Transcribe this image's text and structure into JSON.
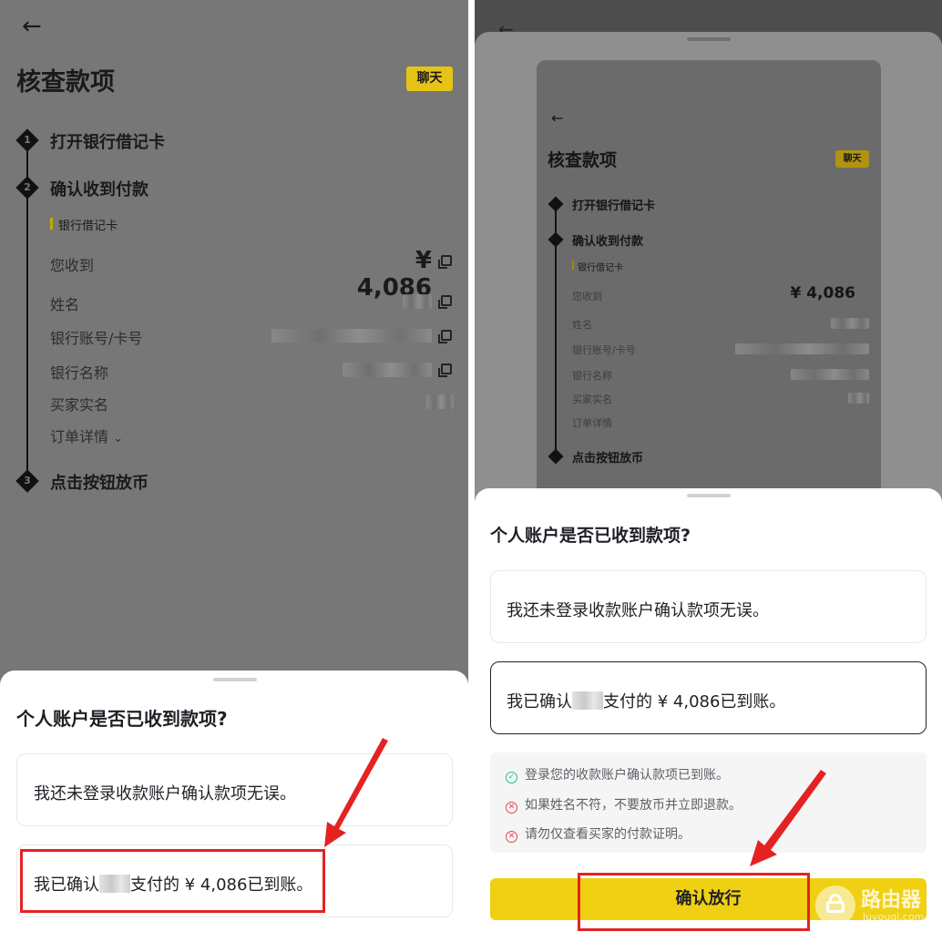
{
  "order": {
    "back_icon": "arrow-left-icon",
    "title": "核查款项",
    "chat_label": "聊天",
    "steps": [
      {
        "num": "1",
        "label": "打开银行借记卡"
      },
      {
        "num": "2",
        "label": "确认收到付款"
      },
      {
        "num": "3",
        "label": "点击按钮放币"
      }
    ],
    "bank_tag": "银行借记卡",
    "rows": {
      "received_label": "您收到",
      "amount": "¥ 4,086",
      "name_label": "姓名",
      "account_label": "银行账号/卡号",
      "bank_name_label": "银行名称",
      "buyer_label": "买家实名",
      "details_label": "订单详情",
      "details_chevron": "⌄"
    }
  },
  "sheet": {
    "title": "个人账户是否已收到款项?",
    "option_not_logged": "我还未登录收款账户确认款项无误。",
    "option_confirm_prefix": "我已确认",
    "option_confirm_suffix": "支付的 ¥ 4,086已到账。",
    "hints": [
      {
        "icon": "check-circle-icon",
        "text": "登录您的收款账户确认款项已到账。"
      },
      {
        "icon": "x-circle-icon",
        "text": "如果姓名不符，不要放币并立即退款。"
      },
      {
        "icon": "x-circle-icon",
        "text": "请勿仅查看买家的付款证明。"
      }
    ],
    "confirm_button": "确认放行"
  },
  "watermark": {
    "title": "路由器",
    "url": "luyouqi.com"
  },
  "colors": {
    "accent_yellow": "#f0d012",
    "highlight_red": "#e52222",
    "ok_green": "#2ebd85",
    "error_red": "#e8435a"
  }
}
